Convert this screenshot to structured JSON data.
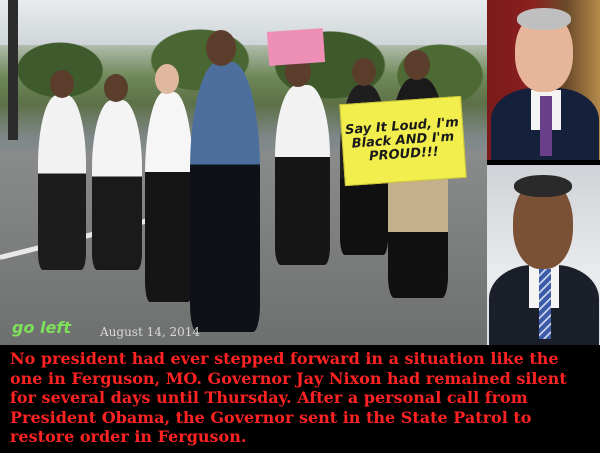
{
  "photo": {
    "sign_text": "Say It Loud, I'm Black AND I'm PROUD!!!",
    "pink_sign_text": "",
    "watermark": "go left",
    "date": "August 14, 2014"
  },
  "caption": {
    "text": "No president had ever stepped forward in a situation like the one in Ferguson, MO.   Governor Jay Nixon had remained silent for several days until Thursday.   After a personal call from President Obama, the Governor sent in the State Patrol to restore order in Ferguson."
  },
  "colors": {
    "caption": "#ff2222",
    "watermark": "#7ee05a",
    "background": "#000000"
  }
}
